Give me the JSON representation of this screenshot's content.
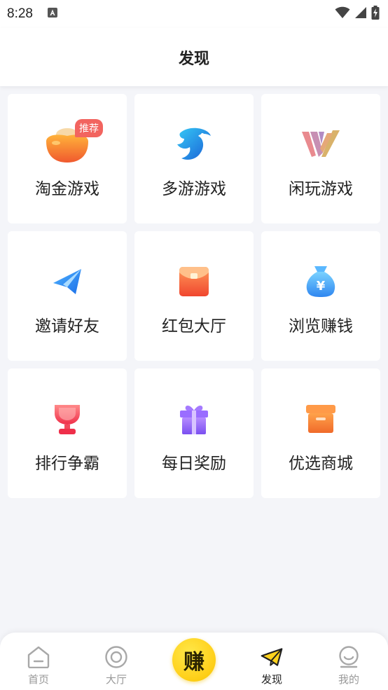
{
  "status_bar": {
    "time": "8:28",
    "icons": [
      "a-notification-icon",
      "wifi-icon",
      "signal-icon",
      "battery-charging-icon"
    ]
  },
  "header": {
    "title": "发现"
  },
  "grid": {
    "items": [
      {
        "label": "淘金游戏",
        "icon": "gold-ingot-icon",
        "badge": "推荐"
      },
      {
        "label": "多游游戏",
        "icon": "dolphin-icon"
      },
      {
        "label": "闲玩游戏",
        "icon": "xianwan-logo-icon"
      },
      {
        "label": "邀请好友",
        "icon": "paper-plane-icon"
      },
      {
        "label": "红包大厅",
        "icon": "red-envelope-icon"
      },
      {
        "label": "浏览赚钱",
        "icon": "money-bag-icon"
      },
      {
        "label": "排行争霸",
        "icon": "trophy-icon"
      },
      {
        "label": "每日奖励",
        "icon": "gift-icon"
      },
      {
        "label": "优选商城",
        "icon": "storage-box-icon"
      }
    ]
  },
  "tab_bar": {
    "tabs": [
      {
        "label": "首页",
        "icon": "home-icon",
        "active": false
      },
      {
        "label": "大厅",
        "icon": "hall-circle-icon",
        "active": false
      },
      {
        "label": "发现",
        "icon": "paper-plane-icon",
        "active": true
      },
      {
        "label": "我的",
        "icon": "profile-smile-icon",
        "active": false
      }
    ],
    "center_button": "赚"
  },
  "colors": {
    "background": "#f4f5f9",
    "badge": "#f2645f",
    "earn_button": "#ffd21e",
    "active_tab": "#222222",
    "inactive_tab": "#999999"
  }
}
